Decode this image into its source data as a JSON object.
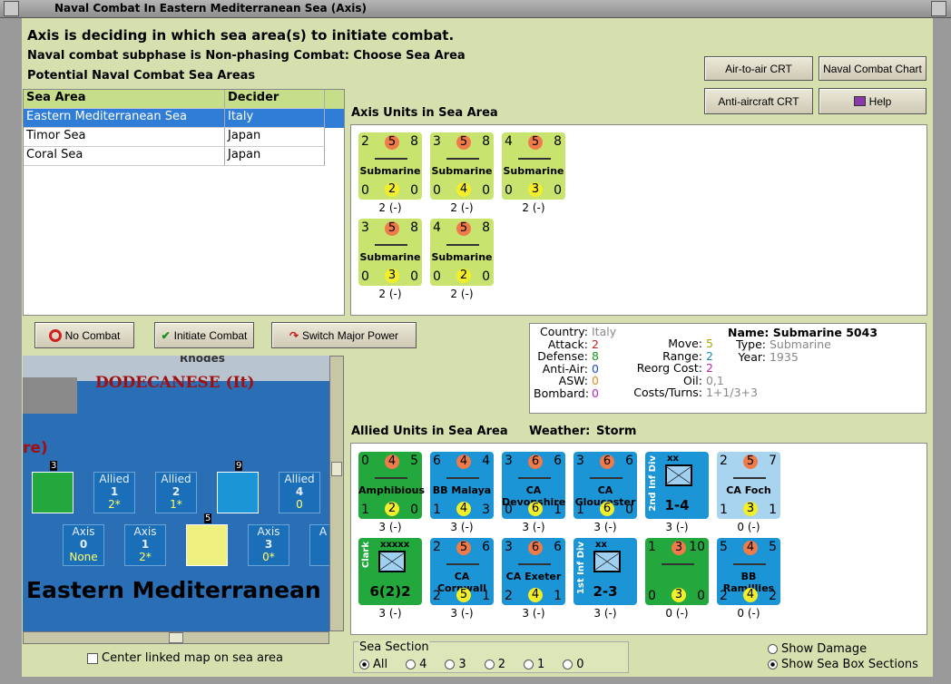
{
  "window": {
    "title": "Naval Combat In Eastern Mediterranean Sea (Axis)"
  },
  "header": {
    "line1": "Axis is deciding in which sea area(s) to initiate combat.",
    "line2": "Naval combat subphase is Non-phasing Combat: Choose Sea Area",
    "line3": "Potential Naval Combat Sea Areas"
  },
  "buttons": {
    "air_to_air": "Air-to-air CRT",
    "naval_chart": "Naval Combat Chart",
    "anti_aircraft": "Anti-aircraft CRT",
    "help": "Help",
    "no_combat": "No Combat",
    "initiate": "Initiate Combat",
    "switch": "Switch Major Power"
  },
  "table": {
    "headers": [
      "Sea Area",
      "Decider"
    ],
    "rows": [
      [
        "Eastern Mediterranean Sea",
        "Italy"
      ],
      [
        "Timor Sea",
        "Japan"
      ],
      [
        "Coral Sea",
        "Japan"
      ]
    ]
  },
  "axis_units_label": "Axis Units in Sea Area",
  "axis_units": [
    {
      "tl": "2",
      "tm": "5",
      "tr": "8",
      "name": "Submarine",
      "bl": "0",
      "bm": "2",
      "br": "0",
      "cap": "2 (-)"
    },
    {
      "tl": "3",
      "tm": "5",
      "tr": "8",
      "name": "Submarine",
      "bl": "0",
      "bm": "4",
      "br": "0",
      "cap": "2 (-)"
    },
    {
      "tl": "4",
      "tm": "5",
      "tr": "8",
      "name": "Submarine",
      "bl": "0",
      "bm": "3",
      "br": "0",
      "cap": "2 (-)"
    },
    {
      "tl": "3",
      "tm": "5",
      "tr": "8",
      "name": "Submarine",
      "bl": "0",
      "bm": "3",
      "br": "0",
      "cap": "2 (-)"
    },
    {
      "tl": "4",
      "tm": "5",
      "tr": "8",
      "name": "Submarine",
      "bl": "0",
      "bm": "2",
      "br": "0",
      "cap": "2 (-)"
    }
  ],
  "allied_label": "Allied Units in Sea Area",
  "weather_label": "Weather:",
  "weather": "Storm",
  "allied_units": [
    {
      "tl": "0",
      "tm": "4",
      "tr": "5",
      "name": "Amphibious",
      "bl": "1",
      "bm": "2",
      "br": "0",
      "cap": "3 (-)",
      "color": "green"
    },
    {
      "tl": "6",
      "tm": "4",
      "tr": "4",
      "name": "BB Malaya",
      "bl": "1",
      "bm": "4",
      "br": "3",
      "cap": "3 (-)",
      "color": "blue"
    },
    {
      "tl": "3",
      "tm": "6",
      "tr": "6",
      "name": "CA Devonshire",
      "bl": "0",
      "bm": "6",
      "br": "1",
      "cap": "3 (-)",
      "color": "blue"
    },
    {
      "tl": "3",
      "tm": "6",
      "tr": "6",
      "name": "CA Gloucester",
      "bl": "1",
      "bm": "6",
      "br": "0",
      "cap": "3 (-)",
      "color": "blue"
    },
    {
      "tl": "",
      "tm": "",
      "tr": "",
      "name": "1-4",
      "bl": "",
      "bm": "",
      "br": "",
      "cap": "3 (-)",
      "color": "blue",
      "corps": "2nd Inf Div",
      "size": "xx"
    },
    {
      "tl": "2",
      "tm": "5",
      "tr": "7",
      "name": "CA Foch",
      "bl": "1",
      "bm": "3",
      "br": "1",
      "cap": "0 (-)",
      "color": "lblue"
    },
    {
      "tl": "",
      "tm": "",
      "tr": "",
      "name": "6(2)2",
      "bl": "",
      "bm": "",
      "br": "",
      "cap": "3 (-)",
      "color": "green",
      "corps": "Clark",
      "size": "xxxxx"
    },
    {
      "tl": "2",
      "tm": "5",
      "tr": "6",
      "name": "CA Cornwall",
      "bl": "2",
      "bm": "5",
      "br": "1",
      "cap": "3 (-)",
      "color": "blue"
    },
    {
      "tl": "3",
      "tm": "6",
      "tr": "6",
      "name": "CA Exeter",
      "bl": "2",
      "bm": "4",
      "br": "1",
      "cap": "3 (-)",
      "color": "blue"
    },
    {
      "tl": "",
      "tm": "",
      "tr": "",
      "name": "2-3",
      "bl": "",
      "bm": "",
      "br": "",
      "cap": "3 (-)",
      "color": "blue",
      "corps": "1st Inf Div",
      "size": "xx"
    },
    {
      "tl": "1",
      "tm": "3",
      "tr": "10",
      "name": "",
      "bl": "0",
      "bm": "3",
      "br": "0",
      "cap": "0 (-)",
      "color": "green"
    },
    {
      "tl": "5",
      "tm": "4",
      "tr": "5",
      "name": "BB Ramillies",
      "bl": "2",
      "bm": "4",
      "br": "2",
      "cap": "0 (-)",
      "color": "blue"
    }
  ],
  "info": {
    "country_k": "Country:",
    "country": "Italy",
    "attack_k": "Attack:",
    "attack": "2",
    "defense_k": "Defense:",
    "defense": "8",
    "aa_k": "Anti-Air:",
    "aa": "0",
    "asw_k": "ASW:",
    "asw": "0",
    "bombard_k": "Bombard:",
    "bombard": "0",
    "move_k": "Move:",
    "move": "5",
    "range_k": "Range:",
    "range": "2",
    "reorg_k": "Reorg Cost:",
    "reorg": "2",
    "oil_k": "Oil:",
    "oil": "0,1",
    "costs_k": "Costs/Turns:",
    "costs": "1+1/3+3",
    "name": "Name: Submarine 5043",
    "type_k": "Type:",
    "type": "Submarine",
    "year_k": "Year:",
    "year": "1935"
  },
  "map": {
    "region": "DODECANESE (It)",
    "rhodes": "Rhodes",
    "re": "re)",
    "sea": "Eastern Mediterranean",
    "boxes_allied": [
      [
        "Allied",
        "1",
        "2*"
      ],
      [
        "Allied",
        "2",
        "1*"
      ],
      [
        "Allied",
        "4",
        "0"
      ]
    ],
    "boxes_axis": [
      [
        "Axis",
        "0",
        "None"
      ],
      [
        "Axis",
        "1",
        "2*"
      ],
      [
        "Axis",
        "3",
        "0*"
      ],
      [
        "A",
        "",
        " "
      ]
    ],
    "box_nums": [
      "3",
      "9",
      "5"
    ]
  },
  "center_map": "Center linked map on sea area",
  "sea_section": {
    "label": "Sea Section",
    "options": [
      "All",
      "4",
      "3",
      "2",
      "1",
      "0"
    ]
  },
  "show_damage": "Show Damage",
  "show_sections": "Show Sea Box Sections"
}
